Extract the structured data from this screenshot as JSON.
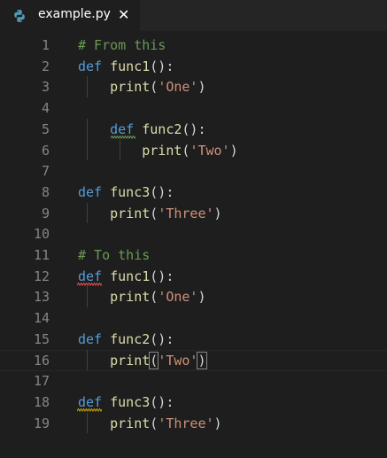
{
  "tab": {
    "title": "example.py",
    "close_glyph": "✕",
    "icon": "python-icon"
  },
  "editor": {
    "lines": [
      {
        "no": "1",
        "tokens": [
          {
            "t": "# From this",
            "c": "cm"
          }
        ]
      },
      {
        "no": "2",
        "tokens": [
          {
            "t": "def",
            "c": "kw"
          },
          {
            "t": " ",
            "c": "pl"
          },
          {
            "t": "func1",
            "c": "fn"
          },
          {
            "t": "():",
            "c": "pl"
          }
        ]
      },
      {
        "no": "3",
        "tokens": [
          {
            "t": "    ",
            "c": "pl"
          },
          {
            "t": "print",
            "c": "fn"
          },
          {
            "t": "(",
            "c": "pl"
          },
          {
            "t": "'One'",
            "c": "str"
          },
          {
            "t": ")",
            "c": "pl"
          }
        ]
      },
      {
        "no": "4",
        "tokens": []
      },
      {
        "no": "5",
        "tokens": [
          {
            "t": "    ",
            "c": "pl"
          },
          {
            "t": "def",
            "c": "kw"
          },
          {
            "t": " ",
            "c": "pl"
          },
          {
            "t": "func2",
            "c": "fn"
          },
          {
            "t": "():",
            "c": "pl"
          }
        ]
      },
      {
        "no": "6",
        "tokens": [
          {
            "t": "        ",
            "c": "pl"
          },
          {
            "t": "print",
            "c": "fn"
          },
          {
            "t": "(",
            "c": "pl"
          },
          {
            "t": "'Two'",
            "c": "str"
          },
          {
            "t": ")",
            "c": "pl"
          }
        ]
      },
      {
        "no": "7",
        "tokens": []
      },
      {
        "no": "8",
        "tokens": [
          {
            "t": "def",
            "c": "kw"
          },
          {
            "t": " ",
            "c": "pl"
          },
          {
            "t": "func3",
            "c": "fn"
          },
          {
            "t": "():",
            "c": "pl"
          }
        ]
      },
      {
        "no": "9",
        "tokens": [
          {
            "t": "    ",
            "c": "pl"
          },
          {
            "t": "print",
            "c": "fn"
          },
          {
            "t": "(",
            "c": "pl"
          },
          {
            "t": "'Three'",
            "c": "str"
          },
          {
            "t": ")",
            "c": "pl"
          }
        ]
      },
      {
        "no": "10",
        "tokens": []
      },
      {
        "no": "11",
        "tokens": [
          {
            "t": "# To this",
            "c": "cm"
          }
        ]
      },
      {
        "no": "12",
        "tokens": [
          {
            "t": "def",
            "c": "kw"
          },
          {
            "t": " ",
            "c": "pl"
          },
          {
            "t": "func1",
            "c": "fn"
          },
          {
            "t": "():",
            "c": "pl"
          }
        ]
      },
      {
        "no": "13",
        "tokens": [
          {
            "t": "    ",
            "c": "pl"
          },
          {
            "t": "print",
            "c": "fn"
          },
          {
            "t": "(",
            "c": "pl"
          },
          {
            "t": "'One'",
            "c": "str"
          },
          {
            "t": ")",
            "c": "pl"
          }
        ]
      },
      {
        "no": "14",
        "tokens": []
      },
      {
        "no": "15",
        "tokens": [
          {
            "t": "def",
            "c": "kw"
          },
          {
            "t": " ",
            "c": "pl"
          },
          {
            "t": "func2",
            "c": "fn"
          },
          {
            "t": "():",
            "c": "pl"
          }
        ]
      },
      {
        "no": "16",
        "tokens": [
          {
            "t": "    ",
            "c": "pl"
          },
          {
            "t": "print",
            "c": "fn"
          },
          {
            "t": "(",
            "c": "pl"
          },
          {
            "t": "'Two'",
            "c": "str"
          },
          {
            "t": ")",
            "c": "pl"
          }
        ]
      },
      {
        "no": "17",
        "tokens": []
      },
      {
        "no": "18",
        "tokens": [
          {
            "t": "def",
            "c": "kw"
          },
          {
            "t": " ",
            "c": "pl"
          },
          {
            "t": "func3",
            "c": "fn"
          },
          {
            "t": "():",
            "c": "pl"
          }
        ]
      },
      {
        "no": "19",
        "tokens": [
          {
            "t": "    ",
            "c": "pl"
          },
          {
            "t": "print",
            "c": "fn"
          },
          {
            "t": "(",
            "c": "pl"
          },
          {
            "t": "'Three'",
            "c": "str"
          },
          {
            "t": ")",
            "c": "pl"
          }
        ]
      }
    ],
    "active_line": "16"
  },
  "colors": {
    "background": "#1e1e1e",
    "keyword": "#569cd6",
    "function": "#dcdcaa",
    "string": "#ce9178",
    "comment": "#6a9955",
    "line_number": "#858585",
    "squiggle_warning": "#6a9955",
    "squiggle_error": "#f14c4c",
    "squiggle_info": "#cca700"
  }
}
